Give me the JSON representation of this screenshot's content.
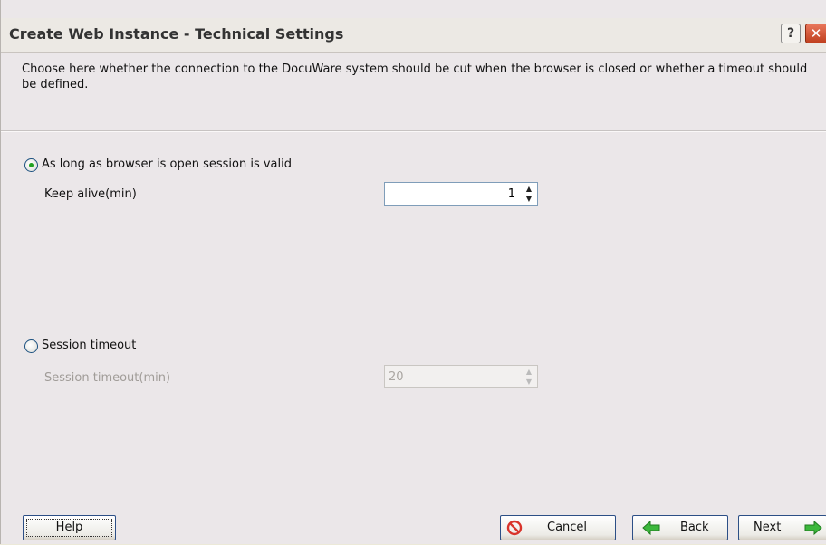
{
  "window": {
    "title": "Create Web Instance - Technical Settings",
    "help_icon": "?",
    "close_icon": "✕"
  },
  "description": "Choose here whether the connection to the DocuWare system should be cut when the browser is closed or whether a timeout should be defined.",
  "options": {
    "browser_session": {
      "label": "As long as browser is open session is valid",
      "selected": true,
      "keep_alive_label": "Keep alive(min)",
      "keep_alive_value": "1"
    },
    "session_timeout": {
      "label": "Session timeout",
      "selected": false,
      "timeout_label": "Session timeout(min)",
      "timeout_value": "20"
    }
  },
  "buttons": {
    "help": "Help",
    "cancel": "Cancel",
    "back": "Back",
    "next": "Next"
  },
  "icons": {
    "help": "question-mark-icon",
    "close": "close-icon",
    "cancel": "no-entry-icon",
    "back": "green-arrow-left-icon",
    "next": "green-arrow-right-icon"
  },
  "colors": {
    "radio_dot": "#21a121",
    "arrow_green": "#3cb83c",
    "cancel_red": "#d9342b"
  }
}
